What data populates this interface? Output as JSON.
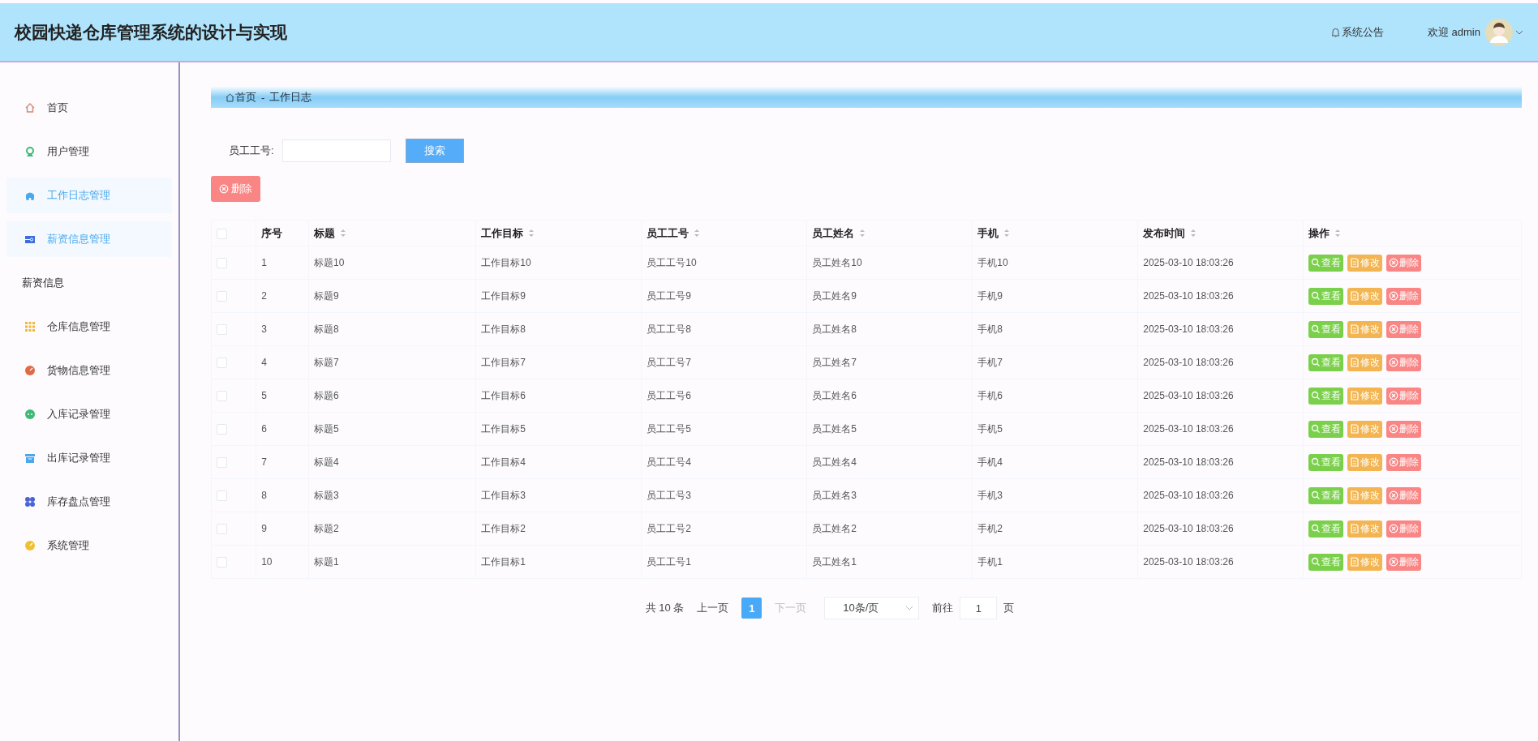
{
  "header": {
    "title": "校园快递仓库管理系统的设计与实现",
    "notice": "系统公告",
    "welcome": "欢迎 admin"
  },
  "sidebar": {
    "items": [
      {
        "label": "首页",
        "selected": false
      },
      {
        "label": "用户管理",
        "selected": false
      },
      {
        "label": "工作日志管理",
        "selected": true
      },
      {
        "label": "薪资信息管理",
        "selected": true,
        "children": [
          {
            "label": "薪资信息",
            "selected": false
          }
        ]
      },
      {
        "label": "仓库信息管理",
        "selected": false
      },
      {
        "label": "货物信息管理",
        "selected": false
      },
      {
        "label": "入库记录管理",
        "selected": false
      },
      {
        "label": "出库记录管理",
        "selected": false
      },
      {
        "label": "库存盘点管理",
        "selected": false
      },
      {
        "label": "系统管理",
        "selected": false
      }
    ]
  },
  "breadcrumb": {
    "items": [
      "首页",
      "工作日志"
    ],
    "separator": "-"
  },
  "search": {
    "label": "员工工号:",
    "button": "搜索"
  },
  "delete_button": "删除",
  "table": {
    "header_checked": false,
    "columns": [
      {
        "label": "序号",
        "sortable": false
      },
      {
        "label": "标题",
        "sortable": true
      },
      {
        "label": "工作目标",
        "sortable": true
      },
      {
        "label": "员工工号",
        "sortable": true
      },
      {
        "label": "员工姓名",
        "sortable": true
      },
      {
        "label": "手机",
        "sortable": true
      },
      {
        "label": "发布时间",
        "sortable": true
      },
      {
        "label": "操作",
        "sortable": true
      }
    ],
    "rows": [
      {
        "checked": false,
        "cells": [
          "1",
          "标题10",
          "工作目标10",
          "员工工号10",
          "员工姓名10",
          "手机10",
          "2025-03-10 18:03:26"
        ],
        "actions": [
          {
            "kind": "view",
            "label": "查看"
          },
          {
            "kind": "edit",
            "label": "修改"
          },
          {
            "kind": "delete",
            "label": "删除"
          }
        ]
      },
      {
        "checked": false,
        "cells": [
          "2",
          "标题9",
          "工作目标9",
          "员工工号9",
          "员工姓名9",
          "手机9",
          "2025-03-10 18:03:26"
        ],
        "actions": [
          {
            "kind": "view",
            "label": "查看"
          },
          {
            "kind": "edit",
            "label": "修改"
          },
          {
            "kind": "delete",
            "label": "删除"
          }
        ]
      },
      {
        "checked": false,
        "cells": [
          "3",
          "标题8",
          "工作目标8",
          "员工工号8",
          "员工姓名8",
          "手机8",
          "2025-03-10 18:03:26"
        ],
        "actions": [
          {
            "kind": "view",
            "label": "查看"
          },
          {
            "kind": "edit",
            "label": "修改"
          },
          {
            "kind": "delete",
            "label": "删除"
          }
        ]
      },
      {
        "checked": false,
        "cells": [
          "4",
          "标题7",
          "工作目标7",
          "员工工号7",
          "员工姓名7",
          "手机7",
          "2025-03-10 18:03:26"
        ],
        "actions": [
          {
            "kind": "view",
            "label": "查看"
          },
          {
            "kind": "edit",
            "label": "修改"
          },
          {
            "kind": "delete",
            "label": "删除"
          }
        ]
      },
      {
        "checked": false,
        "cells": [
          "5",
          "标题6",
          "工作目标6",
          "员工工号6",
          "员工姓名6",
          "手机6",
          "2025-03-10 18:03:26"
        ],
        "actions": [
          {
            "kind": "view",
            "label": "查看"
          },
          {
            "kind": "edit",
            "label": "修改"
          },
          {
            "kind": "delete",
            "label": "删除"
          }
        ]
      },
      {
        "checked": false,
        "cells": [
          "6",
          "标题5",
          "工作目标5",
          "员工工号5",
          "员工姓名5",
          "手机5",
          "2025-03-10 18:03:26"
        ],
        "actions": [
          {
            "kind": "view",
            "label": "查看"
          },
          {
            "kind": "edit",
            "label": "修改"
          },
          {
            "kind": "delete",
            "label": "删除"
          }
        ]
      },
      {
        "checked": false,
        "cells": [
          "7",
          "标题4",
          "工作目标4",
          "员工工号4",
          "员工姓名4",
          "手机4",
          "2025-03-10 18:03:26"
        ],
        "actions": [
          {
            "kind": "view",
            "label": "查看"
          },
          {
            "kind": "edit",
            "label": "修改"
          },
          {
            "kind": "delete",
            "label": "删除"
          }
        ]
      },
      {
        "checked": false,
        "cells": [
          "8",
          "标题3",
          "工作目标3",
          "员工工号3",
          "员工姓名3",
          "手机3",
          "2025-03-10 18:03:26"
        ],
        "actions": [
          {
            "kind": "view",
            "label": "查看"
          },
          {
            "kind": "edit",
            "label": "修改"
          },
          {
            "kind": "delete",
            "label": "删除"
          }
        ]
      },
      {
        "checked": false,
        "cells": [
          "9",
          "标题2",
          "工作目标2",
          "员工工号2",
          "员工姓名2",
          "手机2",
          "2025-03-10 18:03:26"
        ],
        "actions": [
          {
            "kind": "view",
            "label": "查看"
          },
          {
            "kind": "edit",
            "label": "修改"
          },
          {
            "kind": "delete",
            "label": "删除"
          }
        ]
      },
      {
        "checked": false,
        "cells": [
          "10",
          "标题1",
          "工作目标1",
          "员工工号1",
          "员工姓名1",
          "手机1",
          "2025-03-10 18:03:26"
        ],
        "actions": [
          {
            "kind": "view",
            "label": "查看"
          },
          {
            "kind": "edit",
            "label": "修改"
          },
          {
            "kind": "delete",
            "label": "删除"
          }
        ]
      }
    ]
  },
  "pagination": {
    "total": "共 10 条",
    "prev": "上一页",
    "pages": [
      {
        "label": "1",
        "selected": true
      }
    ],
    "next": "下一页",
    "next_disabled": true,
    "page_size": "10条/页",
    "goto_label": "前往",
    "goto_value": "1",
    "goto_suffix": "页"
  }
}
